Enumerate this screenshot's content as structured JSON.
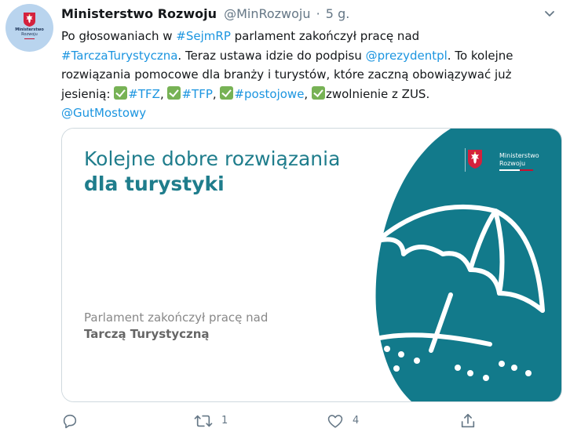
{
  "account": {
    "display_name": "Ministerstwo Rozwoju",
    "handle": "@MinRozwoju",
    "separator": "·",
    "time": "5 g.",
    "avatar_text_line1": "Ministerstwo",
    "avatar_text_line2": "Rozwoju"
  },
  "tweet": {
    "lines": [
      [
        {
          "t": "Po głosowaniach w "
        },
        {
          "t": "#SejmRP",
          "link": true
        },
        {
          "t": " parlament zakończył pracę nad"
        }
      ],
      [
        {
          "t": "#TarczaTurystyczna",
          "link": true
        },
        {
          "t": ". Teraz ustawa idzie do podpisu "
        },
        {
          "t": "@prezydentpl",
          "link": true
        },
        {
          "t": ". To kolejne"
        }
      ],
      [
        {
          "t": "rozwiązania pomocowe dla branży i turystów, które zaczną obowiązywać już"
        }
      ],
      [
        {
          "t": "jesienią: "
        },
        {
          "emoji": "check"
        },
        {
          "t": "#TFZ",
          "link": true
        },
        {
          "t": ", "
        },
        {
          "emoji": "check"
        },
        {
          "t": "#TFP",
          "link": true
        },
        {
          "t": ", "
        },
        {
          "emoji": "check"
        },
        {
          "t": "#postojowe",
          "link": true
        },
        {
          "t": ", "
        },
        {
          "emoji": "check"
        },
        {
          "t": "zwolnienie z ZUS."
        }
      ],
      [
        {
          "t": "@GutMostowy",
          "link": true
        }
      ]
    ]
  },
  "card": {
    "title_line1": "Kolejne dobre rozwiązania",
    "title_line2": "dla turystyki",
    "subtitle_line1": "Parlament zakończył pracę nad",
    "subtitle_line2": "Tarczą Turystyczną",
    "logo_line1": "Ministerstwo",
    "logo_line2": "Rozwoju",
    "icon": "beach-umbrella-icon"
  },
  "actions": {
    "reply": {
      "icon": "reply-icon",
      "count": ""
    },
    "retweet": {
      "icon": "retweet-icon",
      "count": "1"
    },
    "like": {
      "icon": "heart-icon",
      "count": "4"
    },
    "share": {
      "icon": "share-icon",
      "count": ""
    }
  },
  "colors": {
    "link": "#1b95e0",
    "text": "#14171a",
    "muted": "#657786",
    "card_teal": "#1f7d8c",
    "card_panel": "#127a8b",
    "check_green": "#77b255"
  }
}
